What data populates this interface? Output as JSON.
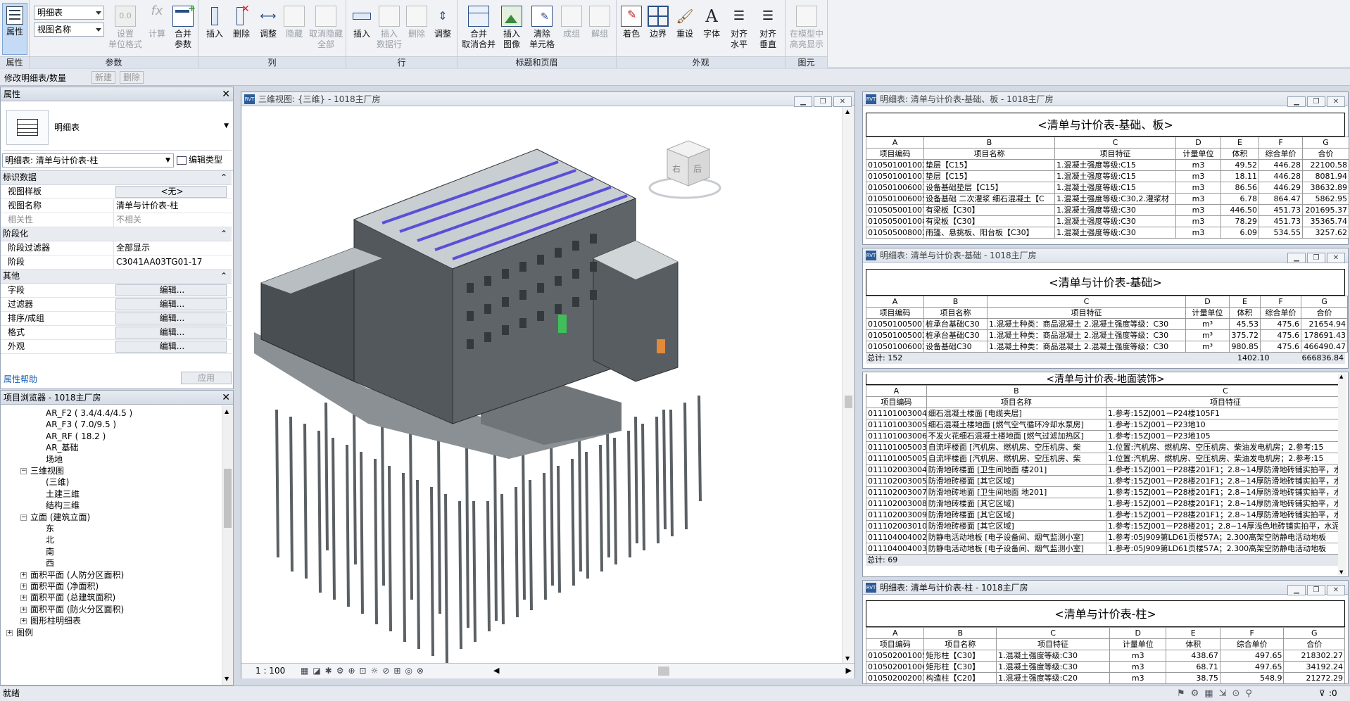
{
  "ribbon": {
    "groups": [
      {
        "label": "属性"
      },
      {
        "label": "参数"
      },
      {
        "label": "列"
      },
      {
        "label": "行"
      },
      {
        "label": "标题和页眉"
      },
      {
        "label": "外观"
      },
      {
        "label": "图元"
      }
    ],
    "properties_button": "属性",
    "dropdown_schedule": "明细表",
    "dropdown_view_name": "视图名称",
    "params": [
      "设置\n单位格式",
      "计算",
      "合并\n参数"
    ],
    "columns": [
      "插入",
      "删除",
      "调整",
      "隐藏",
      "取消隐藏\n全部"
    ],
    "rows": [
      "插入",
      "插入\n数据行",
      "删除",
      "调整"
    ],
    "titles": [
      "合并\n取消合并",
      "插入\n图像",
      "清除\n单元格",
      "成组",
      "解组"
    ],
    "appearance": [
      "着色",
      "边界",
      "重设",
      "字体",
      "对齐\n水平",
      "对齐\n垂直"
    ],
    "elements": [
      "在模型中\n高亮显示"
    ]
  },
  "context_bar": {
    "label": "修改明细表/数量",
    "new_btn": "新建",
    "delete_btn": "删除"
  },
  "properties": {
    "title": "属性",
    "type_name": "明细表",
    "instance_selector": "明细表: 清单与计价表-柱",
    "edit_type": "编辑类型",
    "sections": [
      {
        "name": "标识数据",
        "toggle": "⌃"
      },
      {
        "name": "阶段化",
        "toggle": "⌃"
      },
      {
        "name": "其他",
        "toggle": "⌃"
      }
    ],
    "rows_ident": [
      {
        "k": "视图样板",
        "v": "<无>",
        "button": true
      },
      {
        "k": "视图名称",
        "v": "清单与计价表-柱"
      },
      {
        "k": "相关性",
        "v": "不相关"
      }
    ],
    "rows_phase": [
      {
        "k": "阶段过滤器",
        "v": "全部显示"
      },
      {
        "k": "阶段",
        "v": "C3041AA03TG01-17"
      }
    ],
    "rows_other": [
      {
        "k": "字段",
        "v": "编辑..."
      },
      {
        "k": "过滤器",
        "v": "编辑..."
      },
      {
        "k": "排序/成组",
        "v": "编辑..."
      },
      {
        "k": "格式",
        "v": "编辑..."
      },
      {
        "k": "外观",
        "v": "编辑..."
      }
    ],
    "help": "属性帮助",
    "apply": "应用"
  },
  "browser": {
    "title": "项目浏览器 - 1018主厂房",
    "items": [
      {
        "label": "AR_F2 ( 3.4/4.4/4.5 )",
        "indent": 64
      },
      {
        "label": "AR_F3 ( 7.0/9.5 )",
        "indent": 64
      },
      {
        "label": "AR_RF ( 18.2 )",
        "indent": 64
      },
      {
        "label": "AR_基础",
        "indent": 64
      },
      {
        "label": "场地",
        "indent": 64
      },
      {
        "label": "三维视图",
        "indent": 28,
        "exp": "−"
      },
      {
        "label": "(三维)",
        "indent": 64
      },
      {
        "label": "土建三维",
        "indent": 64
      },
      {
        "label": "结构三维",
        "indent": 64
      },
      {
        "label": "立面 (建筑立面)",
        "indent": 28,
        "exp": "−"
      },
      {
        "label": "东",
        "indent": 64
      },
      {
        "label": "北",
        "indent": 64
      },
      {
        "label": "南",
        "indent": 64
      },
      {
        "label": "西",
        "indent": 64
      },
      {
        "label": "面积平面 (人防分区面积)",
        "indent": 28,
        "exp": "+"
      },
      {
        "label": "面积平面 (净面积)",
        "indent": 28,
        "exp": "+"
      },
      {
        "label": "面积平面 (总建筑面积)",
        "indent": 28,
        "exp": "+"
      },
      {
        "label": "面积平面 (防火分区面积)",
        "indent": 28,
        "exp": "+"
      },
      {
        "label": "图形柱明细表",
        "indent": 28,
        "exp": "+"
      },
      {
        "label": "图例",
        "indent": 8,
        "exp": "+"
      }
    ]
  },
  "view3d": {
    "title": "三维视图: {三维} - 1018主厂房",
    "viewcube_right": "右",
    "viewcube_back": "后",
    "scale": "1 : 100"
  },
  "sched1": {
    "win_title": "明细表: 清单与计价表-基础、板 - 1018主厂房",
    "heading": "<清单与计价表-基础、板>",
    "letters": [
      "A",
      "B",
      "C",
      "D",
      "E",
      "F",
      "G"
    ],
    "headers": [
      "项目编码",
      "项目名称",
      "项目特征",
      "计量单位",
      "体积",
      "综合单价",
      "合价"
    ],
    "rows": [
      [
        "010501001002",
        "垫层【C15】",
        "1.混凝土强度等级:C15",
        "m3",
        "49.52",
        "446.28",
        "22100.58"
      ],
      [
        "010501001003",
        "垫层【C15】",
        "1.混凝土强度等级:C15",
        "m3",
        "18.11",
        "446.28",
        "8081.94"
      ],
      [
        "010501006003",
        "设备基础垫层【C15】",
        "1.混凝土强度等级:C15",
        "m3",
        "86.56",
        "446.29",
        "38632.89"
      ],
      [
        "010501006005",
        "设备基础 二次灌浆 细石混凝土【C",
        "1.混凝土强度等级:C30,2.灌浆材",
        "m3",
        "6.78",
        "864.47",
        "5862.95"
      ],
      [
        "010505001007",
        "有梁板【C30】",
        "1.混凝土强度等级:C30",
        "m3",
        "446.50",
        "451.73",
        "201695.37"
      ],
      [
        "010505001008",
        "有梁板【C30】",
        "1.混凝土强度等级:C30",
        "m3",
        "78.29",
        "451.73",
        "35365.74"
      ],
      [
        "010505008002",
        "雨篷、悬挑板、阳台板【C30】",
        "1.混凝土强度等级:C30",
        "m3",
        "6.09",
        "534.55",
        "3257.62"
      ]
    ]
  },
  "sched2": {
    "win_title": "明细表: 清单与计价表-基础 - 1018主厂房",
    "heading": "<清单与计价表-基础>",
    "letters": [
      "A",
      "B",
      "C",
      "D",
      "E",
      "F",
      "G"
    ],
    "headers": [
      "项目编码",
      "项目名称",
      "项目特征",
      "计量单位",
      "体积",
      "综合单价",
      "合价"
    ],
    "rows": [
      [
        "010501005001",
        "桩承台基础C30",
        "1.混凝土种类：商品混凝土 2.混凝土强度等级：C30",
        "m³",
        "45.53",
        "475.6",
        "21654.94"
      ],
      [
        "010501005002",
        "桩承台基础C30",
        "1.混凝土种类：商品混凝土 2.混凝土强度等级：C30",
        "m³",
        "375.72",
        "475.6",
        "178691.43"
      ],
      [
        "010501006002",
        "设备基础C30",
        "1.混凝土种类：商品混凝土 2.混凝土强度等级：C30",
        "m³",
        "980.85",
        "475.6",
        "466490.47"
      ]
    ],
    "total_label": "总计: 152",
    "total_volume": "1402.10",
    "total_sum": "666836.84"
  },
  "sched3": {
    "heading": "<清单与计价表-地面装饰>",
    "letters": [
      "A",
      "B",
      "C"
    ],
    "headers": [
      "项目编码",
      "项目名称",
      "项目特征"
    ],
    "rows": [
      [
        "011101003004",
        "细石混凝土楼面 [电缆夹层]",
        "1.参考:15ZJ001－P24楼105F1"
      ],
      [
        "011101003005",
        "细石混凝土楼地面 [燃气空气循环冷却水泵房]",
        "1.参考:15ZJ001－P23地10"
      ],
      [
        "011101003006",
        "不发火花细石混凝土楼地面 [燃气过滤加热区]",
        "1.参考:15ZJ001－P23地105"
      ],
      [
        "011101005003",
        "自流坪楼面 [汽机房、燃机房、空压机房、柴",
        "1.位置:汽机房、燃机房、空压机房、柴油发电机房；2.参考:15"
      ],
      [
        "011101005005",
        "自流坪楼面 [汽机房、燃机房、空压机房、柴",
        "1.位置:汽机房、燃机房、空压机房、柴油发电机房；2.参考:15"
      ],
      [
        "011102003004",
        "防滑地砖楼面 [卫生间地面 楼201]",
        "1.参考:15ZJ001－P28楼201F1；2.8~14厚防滑地砖铺实拍平，水"
      ],
      [
        "011102003005",
        "防滑地砖楼面 [其它区域]",
        "1.参考:15ZJ001－P28楼201F1；2.8~14厚防滑地砖铺实拍平，水"
      ],
      [
        "011102003007",
        "防滑地砖地面 [卫生间地面 地201]",
        "1.参考:15ZJ001－P28楼201F1；2.8~14厚防滑地砖铺实拍平，水"
      ],
      [
        "011102003008",
        "防滑地砖楼面 [其它区域]",
        "1.参考:15ZJ001－P28楼201F1；2.8~14厚防滑地砖铺实拍平，水"
      ],
      [
        "011102003009",
        "防滑地砖楼面 [其它区域]",
        "1.参考:15ZJ001－P28楼201F1；2.8~14厚防滑地砖铺实拍平，水"
      ],
      [
        "011102003010",
        "防滑地砖楼面 [其它区域]",
        "1.参考:15ZJ001－P28楼201；2.8~14厚浅色地砖铺实拍平，水泥"
      ],
      [
        "011104004002",
        "防静电活动地板 [电子设备间、烟气监测小室]",
        "1.参考:05J909第LD61页楼57A；2.300高架空防静电活动地板"
      ],
      [
        "011104004003",
        "防静电活动地板 [电子设备间、烟气监测小室]",
        "1.参考:05J909第LD61页楼57A；2.300高架空防静电活动地板"
      ]
    ],
    "total_label": "总计: 69"
  },
  "sched4": {
    "win_title": "明细表: 清单与计价表-柱 - 1018主厂房",
    "heading": "<清单与计价表-柱>",
    "letters": [
      "A",
      "B",
      "C",
      "D",
      "E",
      "F",
      "G"
    ],
    "headers": [
      "项目编码",
      "项目名称",
      "项目特征",
      "计量单位",
      "体积",
      "综合单价",
      "合价"
    ],
    "rows": [
      [
        "010502001005",
        "矩形柱【C30】",
        "1.混凝土强度等级:C30",
        "m3",
        "438.67",
        "497.65",
        "218302.27"
      ],
      [
        "010502001006",
        "矩形柱【C30】",
        "1.混凝土强度等级:C30",
        "m3",
        "68.71",
        "497.65",
        "34192.24"
      ],
      [
        "010502002003",
        "构造柱【C20】",
        "1.混凝土强度等级:C20",
        "m3",
        "38.75",
        "548.9",
        "21272.29"
      ]
    ]
  },
  "status": {
    "text": "就绪",
    "filter_count": ":0"
  }
}
